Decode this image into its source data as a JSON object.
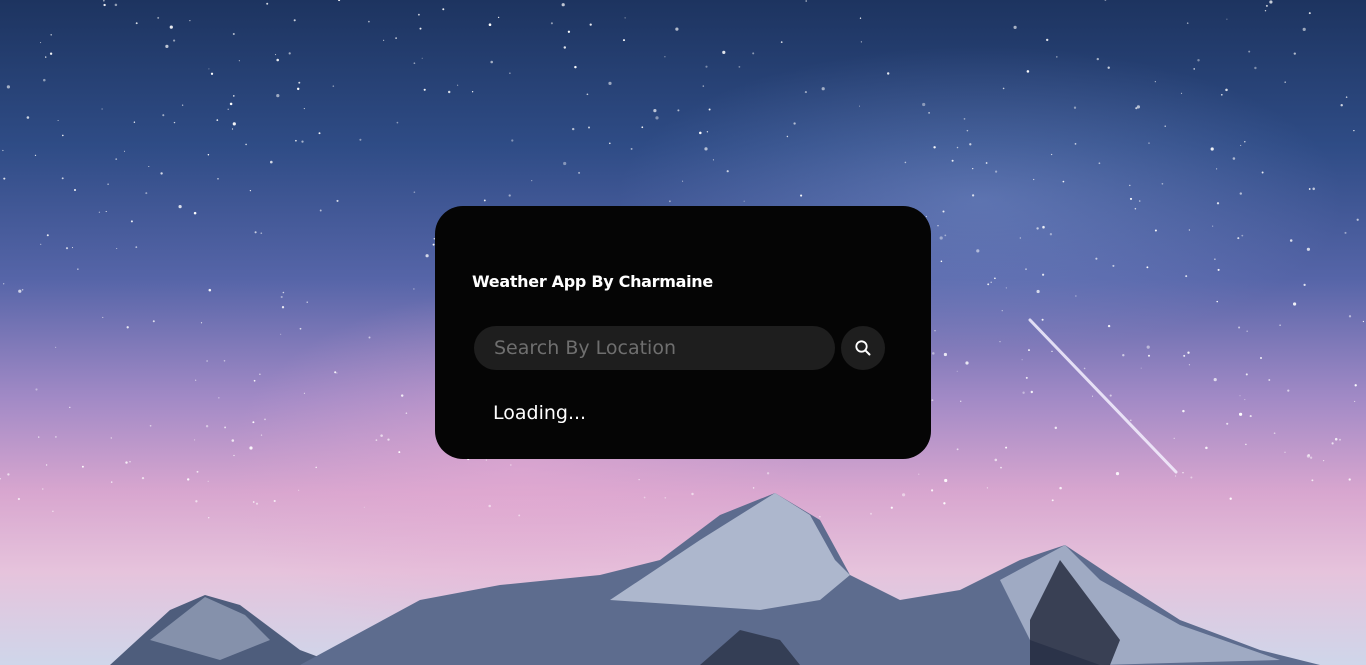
{
  "app": {
    "title": "Weather App By Charmaine"
  },
  "search": {
    "placeholder": "Search By Location",
    "value": "",
    "button_icon": "search-icon"
  },
  "status": {
    "text": "Loading..."
  },
  "theme": {
    "card_background": "#050505",
    "input_background": "#1e1e1e",
    "text_color": "#ffffff",
    "placeholder_color": "#6f6f6f"
  }
}
